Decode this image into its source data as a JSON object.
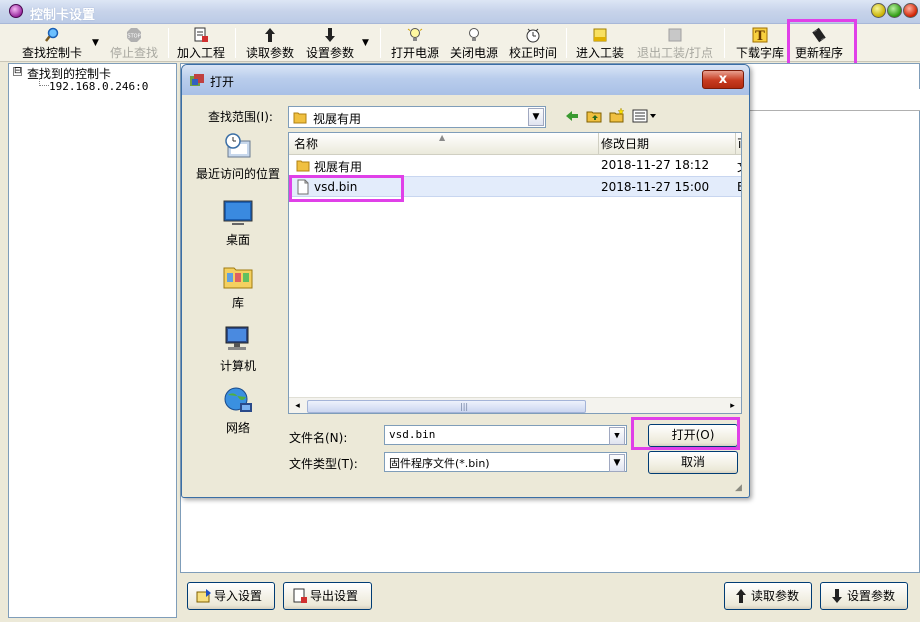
{
  "window": {
    "title": "控制卡设置"
  },
  "toolbar": {
    "find_card": "查找控制卡",
    "stop_find": "停止查找",
    "add_project": "加入工程",
    "read_params": "读取参数",
    "set_params": "设置参数",
    "power_on": "打开电源",
    "power_off": "关闭电源",
    "sync_time": "校正时间",
    "enter_setup": "进入工装",
    "exit_setup": "退出工装/打点",
    "download_font": "下载字库",
    "update_program": "更新程序"
  },
  "tree": {
    "expander": "⊟",
    "root": "查找到的控制卡",
    "child": "192.168.0.246:0"
  },
  "bottom": {
    "import_settings": "导入设置",
    "export_settings": "导出设置",
    "read_params": "读取参数",
    "set_params": "设置参数"
  },
  "dialog": {
    "title": "打开",
    "close": "x",
    "look_in_label": "查找范围(I):",
    "look_in_value": "视展有用",
    "places": [
      {
        "label": "最近访问的位置",
        "icon": "recent-places-icon"
      },
      {
        "label": "桌面",
        "icon": "desktop-icon"
      },
      {
        "label": "库",
        "icon": "libraries-icon"
      },
      {
        "label": "计算机",
        "icon": "computer-icon"
      },
      {
        "label": "网络",
        "icon": "network-icon"
      }
    ],
    "columns": {
      "name": "名称",
      "date": "修改日期",
      "extra": "ī"
    },
    "files": [
      {
        "name": "视展有用",
        "date": "2018-11-27 18:12",
        "extra": "文",
        "type": "folder"
      },
      {
        "name": "vsd.bin",
        "date": "2018-11-27 15:00",
        "extra": "B",
        "type": "file"
      }
    ],
    "scroll": {
      "left": "◂",
      "right": "▸",
      "grip": "|||"
    },
    "filename_label": "文件名(N):",
    "filename_value": "vsd.bin",
    "filetype_label": "文件类型(T):",
    "filetype_value": "固件程序文件(*.bin)",
    "open_button": "打开(O)",
    "cancel_button": "取消"
  },
  "colors": {
    "highlight": "#e040e8",
    "selection": "#e3ecfb",
    "accent": "#3a6ea5"
  }
}
